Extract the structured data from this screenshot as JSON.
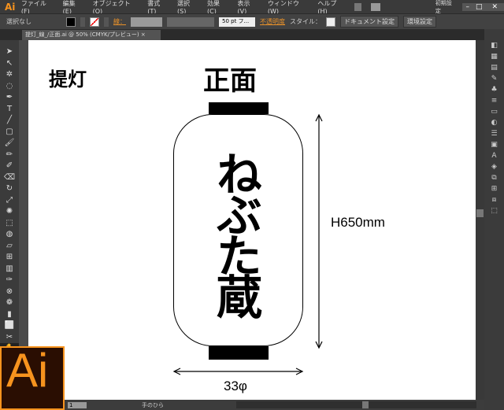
{
  "app": {
    "logo": "Ai",
    "accent": "#f7931e"
  },
  "menu": [
    "ファイル(F)",
    "編集(E)",
    "オブジェクト(O)",
    "書式(T)",
    "選択(S)",
    "効果(C)",
    "表示(V)",
    "ウィンドウ(W)",
    "ヘルプ(H)"
  ],
  "workspace": "初期設定",
  "window_controls": {
    "minimize": "–",
    "maximize": "□",
    "close": "✕"
  },
  "control": {
    "selection": "選択なし",
    "stroke_label": "線：",
    "stroke_size": "50 pt フ...",
    "opacity_label": "不透明度",
    "style_label": "スタイル：",
    "doc_settings": "ドキュメント設定",
    "env_settings": "環境設定"
  },
  "document_tab": {
    "title": "提灯_線_/正面.ai @ 50% (CMYK/プレビュー)",
    "close": "×"
  },
  "artwork": {
    "label": "提灯",
    "view": "正面",
    "calligraphy": "ねぶた蔵",
    "height": "H650mm",
    "diameter": "33φ"
  },
  "status": {
    "zoom": "1",
    "tool": "手のひら"
  },
  "icons": [
    "selection-icon",
    "direct-selection-icon",
    "magic-wand-icon",
    "lasso-icon",
    "pen-icon",
    "type-icon",
    "line-icon",
    "rectangle-icon",
    "paintbrush-icon",
    "pencil-icon",
    "blob-brush-icon",
    "eraser-icon",
    "rotate-icon",
    "scale-icon",
    "warp-icon",
    "free-transform-icon",
    "shape-builder-icon",
    "perspective-icon",
    "mesh-icon",
    "gradient-icon",
    "eyedropper-icon",
    "blend-icon",
    "symbol-sprayer-icon",
    "graph-icon",
    "artboard-icon",
    "slice-icon",
    "hand-icon",
    "zoom-icon"
  ]
}
